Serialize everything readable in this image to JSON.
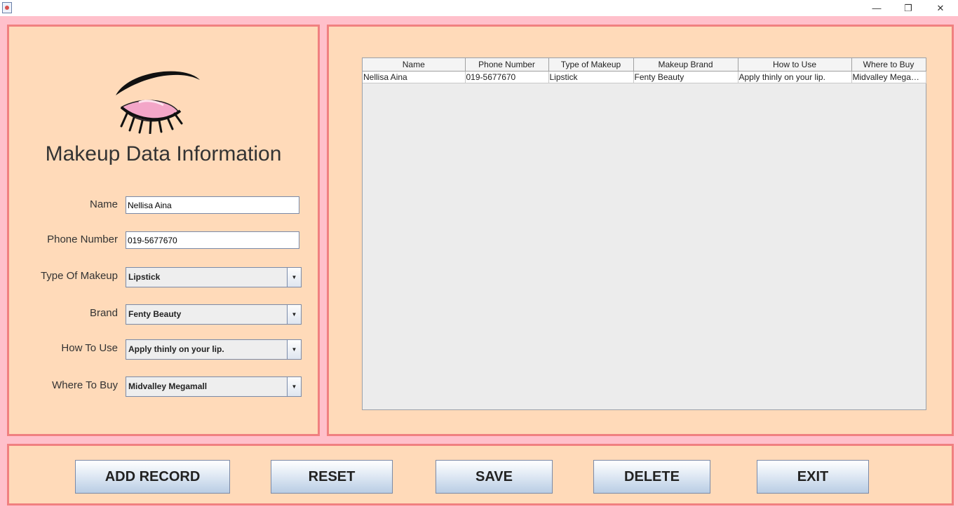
{
  "window": {
    "minimize_glyph": "—",
    "restore_glyph": "❐",
    "close_glyph": "✕"
  },
  "form": {
    "title": "Makeup Data Information",
    "name_label": "Name",
    "name_value": "Nellisa Aina",
    "phone_label": "Phone Number",
    "phone_value": "019-5677670",
    "type_label": "Type Of Makeup",
    "type_value": "Lipstick",
    "brand_label": "Brand",
    "brand_value": "Fenty Beauty",
    "howto_label": "How To Use",
    "howto_value": "Apply thinly on your lip.",
    "where_label": "Where To Buy",
    "where_value": "Midvalley Megamall",
    "dropdown_glyph": "▼"
  },
  "table": {
    "headers": [
      "Name",
      "Phone Number",
      "Type of Makeup",
      "Makeup Brand",
      "How to Use",
      "Where to Buy"
    ],
    "rows": [
      [
        "Nellisa Aina",
        "019-5677670",
        "Lipstick",
        "Fenty Beauty",
        "Apply thinly on your lip.",
        "Midvalley Megamall"
      ]
    ]
  },
  "buttons": {
    "add": "ADD RECORD",
    "reset": "RESET",
    "save": "SAVE",
    "delete": "DELETE",
    "exit": "EXIT"
  },
  "colors": {
    "window_bg": "#ffc0cb",
    "panel_bg": "#ffdab9",
    "panel_border": "#f08080"
  }
}
